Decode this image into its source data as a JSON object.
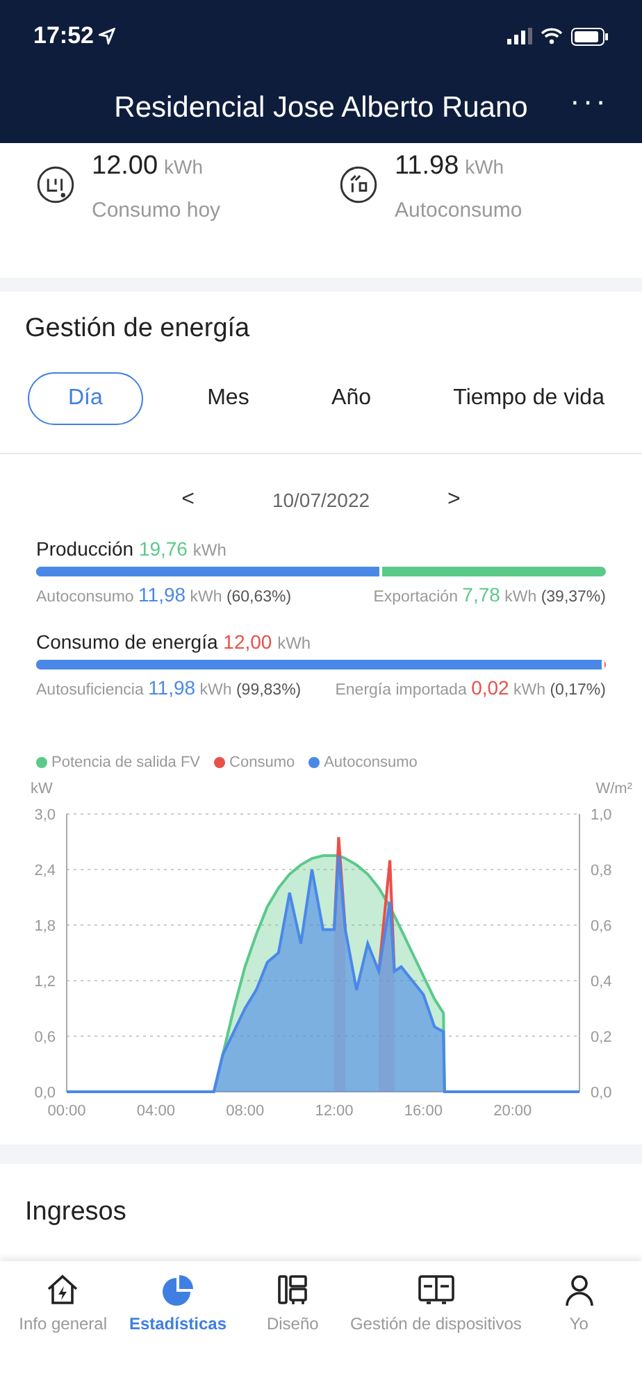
{
  "status_bar": {
    "time": "17:52"
  },
  "header": {
    "title": "Residencial Jose Alberto Ruano",
    "menu": "···"
  },
  "summary": [
    {
      "kind": "consumption",
      "value": "12.00",
      "unit": "kWh",
      "label": "Consumo hoy"
    },
    {
      "kind": "selfuse",
      "value": "11.98",
      "unit": "kWh",
      "label": "Autoconsumo"
    }
  ],
  "energy": {
    "title": "Gestión de energía",
    "tabs": [
      {
        "label": "Día",
        "selected": true
      },
      {
        "label": "Mes",
        "selected": false
      },
      {
        "label": "Año",
        "selected": false
      },
      {
        "label": "Tiempo de vida",
        "selected": false
      }
    ],
    "date": {
      "prev": "<",
      "value": "10/07/2022",
      "next": ">"
    },
    "bars": [
      {
        "label": "Producción",
        "value": "19,76",
        "unit": "kWh",
        "color": "#5bc98a",
        "level": 0.6063,
        "parts": [
          {
            "label": "Autoconsumo",
            "value": "11,98",
            "unit": "kWh",
            "percent": "(60,63%)",
            "color": "#4a88e8"
          },
          {
            "label": "Exportación",
            "value": "7,78",
            "unit": "kWh",
            "percent": "(39,37%)",
            "color": "#5bc98a"
          }
        ]
      },
      {
        "label": "Consumo de energía",
        "value": "12,00",
        "unit": "kWh",
        "color": "#e8504a",
        "level": 0.9983,
        "parts": [
          {
            "label": "Autosuficiencia",
            "value": "11,98",
            "unit": "kWh",
            "percent": "(99,83%)",
            "color": "#4a88e8"
          },
          {
            "label": "Energía importada",
            "value": "0,02",
            "unit": "kWh",
            "percent": "(0,17%)",
            "color": "#e8504a"
          }
        ]
      }
    ],
    "chart_data": {
      "type": "area",
      "ylabel": "kW",
      "grid": true,
      "x": [
        0,
        6.6,
        7,
        7.5,
        8,
        8.5,
        9,
        9.5,
        10,
        10.5,
        11,
        11.5,
        12,
        12.2,
        12.5,
        13,
        13.5,
        14,
        14.5,
        14.7,
        15,
        15.5,
        16,
        16.5,
        16.9,
        16.95,
        23
      ],
      "series": [
        {
          "name": "Potencia de salida FV",
          "color": "#5bc98a",
          "values": [
            null,
            0,
            0.4,
            0.9,
            1.35,
            1.7,
            2.0,
            2.2,
            2.35,
            2.45,
            2.52,
            2.55,
            2.55,
            2.55,
            2.52,
            2.45,
            2.35,
            2.2,
            2.0,
            1.9,
            1.75,
            1.5,
            1.25,
            1.0,
            0.85,
            0,
            null
          ]
        },
        {
          "name": "Consumo",
          "color": "#e8504a",
          "values": [
            null,
            null,
            null,
            null,
            null,
            null,
            null,
            null,
            null,
            null,
            null,
            null,
            1.75,
            2.75,
            1.75,
            null,
            null,
            1.3,
            2.5,
            1.3,
            null,
            null,
            null,
            null,
            null,
            null,
            null
          ]
        },
        {
          "name": "Autoconsumo",
          "color": "#4a88e8",
          "values": [
            0,
            0,
            0.4,
            0.65,
            0.9,
            1.1,
            1.4,
            1.5,
            2.15,
            1.6,
            2.4,
            1.75,
            1.75,
            2.55,
            1.75,
            1.1,
            1.6,
            1.3,
            2.05,
            1.3,
            1.35,
            1.2,
            1.05,
            0.7,
            0.65,
            0,
            0
          ]
        }
      ],
      "xlim": [
        0,
        23
      ],
      "ylim": [
        0,
        3
      ],
      "xticks": [
        {
          "value": 0,
          "label": "00:00"
        },
        {
          "value": 4,
          "label": "04:00"
        },
        {
          "value": 8,
          "label": "08:00"
        },
        {
          "value": 12,
          "label": "12:00"
        },
        {
          "value": 16,
          "label": "16:00"
        },
        {
          "value": 20,
          "label": "20:00"
        }
      ],
      "yticks": [
        {
          "value": 0,
          "label": "0,0"
        },
        {
          "value": 0.6,
          "label": "0,6"
        },
        {
          "value": 1.2,
          "label": "1,2"
        },
        {
          "value": 1.8,
          "label": "1,8"
        },
        {
          "value": 2.4,
          "label": "2,4"
        },
        {
          "value": 3,
          "label": "3,0"
        }
      ]
    },
    "chart_right_axis": {
      "label": "W/m²",
      "ticks": [
        "1,0",
        "0,8",
        "0,6",
        "0,4",
        "0,2",
        "0,0"
      ]
    }
  },
  "income": {
    "title": "Ingresos"
  },
  "nav": [
    {
      "kind": "home",
      "label": "Info general",
      "selected": false
    },
    {
      "kind": "stats",
      "label": "Estadísticas",
      "selected": true
    },
    {
      "kind": "layout",
      "label": "Diseño",
      "selected": false
    },
    {
      "kind": "devices",
      "label": "Gestión de dispositivos",
      "selected": false
    },
    {
      "kind": "user",
      "label": "Yo",
      "selected": false
    }
  ]
}
